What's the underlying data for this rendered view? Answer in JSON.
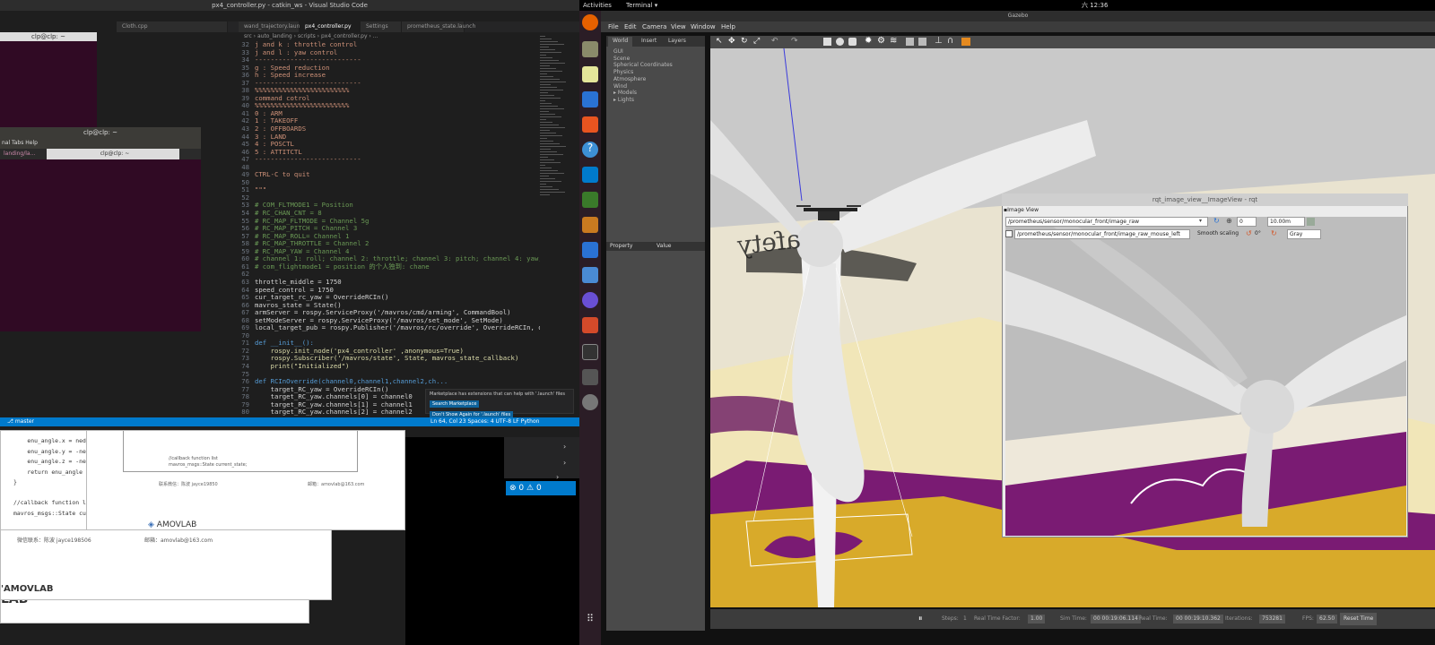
{
  "topbar": {
    "activities": "Activities",
    "app_menu": "Terminal ▾",
    "clock": "六 12:36",
    "app_name": "Gazebo"
  },
  "vscode": {
    "title": "px4_controller.py - catkin_ws - Visual Studio Code",
    "tabs": [
      "Cloth.cpp",
      "wand_trajectory.launch",
      "px4_controller.py",
      "Settings",
      "prometheus_state.launch"
    ],
    "breadcrumb": "src › auto_landing › scripts › px4_controller.py › ...",
    "code_lines": [
      {
        "n": "32",
        "t": "j and k : throttle control",
        "c": "cm"
      },
      {
        "n": "33",
        "t": "j and l : yaw control",
        "c": "cm"
      },
      {
        "n": "34",
        "t": "---------------------------",
        "c": "cm"
      },
      {
        "n": "35",
        "t": "g : Speed reduction",
        "c": "cm"
      },
      {
        "n": "36",
        "t": "h : Speed increase",
        "c": "cm"
      },
      {
        "n": "37",
        "t": "---------------------------",
        "c": "cm"
      },
      {
        "n": "38",
        "t": "%%%%%%%%%%%%%%%%%%%%%%%%",
        "c": "cm"
      },
      {
        "n": "39",
        "t": "command cotrol",
        "c": "cm"
      },
      {
        "n": "40",
        "t": "%%%%%%%%%%%%%%%%%%%%%%%%",
        "c": "cm"
      },
      {
        "n": "41",
        "t": "0 : ARM",
        "c": "cm"
      },
      {
        "n": "42",
        "t": "1 : TAKEOFF",
        "c": "cm"
      },
      {
        "n": "43",
        "t": "2 : OFFBOARDS",
        "c": "cm"
      },
      {
        "n": "44",
        "t": "3 : LAND",
        "c": "cm"
      },
      {
        "n": "45",
        "t": "4 : POSCTL",
        "c": "cm"
      },
      {
        "n": "46",
        "t": "5 : ATTITCTL",
        "c": "cm"
      },
      {
        "n": "47",
        "t": "---------------------------",
        "c": "cm"
      },
      {
        "n": "48",
        "t": "",
        "c": "tx"
      },
      {
        "n": "49",
        "t": "CTRL-C to quit",
        "c": "cm"
      },
      {
        "n": "50",
        "t": "",
        "c": "tx"
      },
      {
        "n": "51",
        "t": "\"\"\"",
        "c": "cm"
      },
      {
        "n": "52",
        "t": "",
        "c": "tx"
      },
      {
        "n": "53",
        "t": "# COM_FLTMODE1 = Position",
        "c": "cmt"
      },
      {
        "n": "54",
        "t": "# RC_CHAN_CNT = 8",
        "c": "cmt"
      },
      {
        "n": "55",
        "t": "# RC_MAP_FLTMODE = Channel 5g",
        "c": "cmt"
      },
      {
        "n": "56",
        "t": "# RC_MAP_PITCH = Channel 3",
        "c": "cmt"
      },
      {
        "n": "57",
        "t": "# RC_MAP_ROLL= Channel 1",
        "c": "cmt"
      },
      {
        "n": "58",
        "t": "# RC_MAP_THROTTLE = Channel 2",
        "c": "cmt"
      },
      {
        "n": "59",
        "t": "# RC_MAP_YAW = Channel 4",
        "c": "cmt"
      },
      {
        "n": "60",
        "t": "# channel 1: roll; channel 2: throttle; channel 3: pitch; channel 4: yaw; cha",
        "c": "cmt"
      },
      {
        "n": "61",
        "t": "# com_flightmode1 = position 的个人独到: chane",
        "c": "cmt"
      },
      {
        "n": "62",
        "t": "",
        "c": "tx"
      },
      {
        "n": "63",
        "t": "throttle_middle = 1750",
        "c": "tx"
      },
      {
        "n": "64",
        "t": "speed_control = 1750",
        "c": "tx"
      },
      {
        "n": "65",
        "t": "cur_target_rc_yaw = OverrideRCIn()",
        "c": "tx"
      },
      {
        "n": "66",
        "t": "mavros_state = State()",
        "c": "tx"
      },
      {
        "n": "67",
        "t": "armServer = rospy.ServiceProxy('/mavros/cmd/arming', CommandBool)",
        "c": "tx"
      },
      {
        "n": "68",
        "t": "setModeServer = rospy.ServiceProxy('/mavros/set_mode', SetMode)",
        "c": "tx"
      },
      {
        "n": "69",
        "t": "local_target_pub = rospy.Publisher('/mavros/rc/override', OverrideRCIn, queue",
        "c": "tx"
      },
      {
        "n": "70",
        "t": "",
        "c": "tx"
      },
      {
        "n": "71",
        "t": "def __init__():",
        "c": "kw"
      },
      {
        "n": "72",
        "t": "    rospy.init_node('px4_controller' ,anonymous=True)",
        "c": "fn"
      },
      {
        "n": "73",
        "t": "    rospy.Subscriber('/mavros/state', State, mavros_state_callback)",
        "c": "fn"
      },
      {
        "n": "74",
        "t": "    print(\"Initialized\")",
        "c": "fn"
      },
      {
        "n": "75",
        "t": "",
        "c": "tx"
      },
      {
        "n": "76",
        "t": "def RCInOverride(channel0,channel1,channel2,ch...",
        "c": "kw"
      },
      {
        "n": "77",
        "t": "    target_RC_yaw = OverrideRCIn()",
        "c": "tx"
      },
      {
        "n": "78",
        "t": "    target_RC_yaw.channels[0] = channel0",
        "c": "tx"
      },
      {
        "n": "79",
        "t": "    target_RC_yaw.channels[1] = channel1",
        "c": "tx"
      },
      {
        "n": "80",
        "t": "    target_RC_yaw.channels[2] = channel2",
        "c": "tx"
      }
    ],
    "notification": "Marketplace has extensions that can help with '.launch' files",
    "notif_btn1": "Search Marketplace",
    "notif_btn2": "Don't Show Again for '.launch' files",
    "status_left": "⎇ master",
    "status_right": "Ln 64, Col 23   Spaces: 4   UTF-8   LF   Python"
  },
  "terminal1": {
    "title": "clp@clp: ~"
  },
  "terminal2": {
    "title": "clp@clp: ~",
    "menu": "nal  Tabs  Help",
    "tab1": "landing/la...",
    "tab2": "clp@clp: ~"
  },
  "doc": {
    "code": [
      "    enu_angle.x = ned_a",
      "    enu_angle.y = -ned_a",
      "    enu_angle.z = -ned_a",
      "    return enu_angle",
      "}",
      "",
      "//callback function list",
      "mavros_msgs::State curre"
    ],
    "box_text1": "//callback function list",
    "box_text2": "mavros_msgs::State current_state;",
    "footer1a": "联系微信：陈波 jayce19850",
    "footer1b": "邮箱：amovlab@163.com",
    "logo": "AMOVLAB",
    "logo_bottom": "'AMOVLAB",
    "logo_cut": "LAB",
    "footer2a": "微信联系：陈波 jayce198506",
    "footer2b": "邮箱：amovlab@163.com",
    "errors": "0",
    "warnings": "0"
  },
  "gazebo": {
    "title": "Gazebo",
    "menu": [
      "File",
      "Edit",
      "Camera",
      "View",
      "Window",
      "Help"
    ],
    "tabs": [
      "World",
      "Insert",
      "Layers"
    ],
    "tree": [
      "GUI",
      "Scene",
      "Spherical Coordinates",
      "Physics",
      "Atmosphere",
      "Wind",
      "▸ Models",
      "▸ Lights"
    ],
    "prop_header": "Property",
    "value_header": "Value",
    "bottom": {
      "steps_label": "Steps:",
      "steps": "1",
      "rtf_label": "Real Time Factor:",
      "rtf": "1.00",
      "sim_label": "Sim Time:",
      "sim": "00 00:19:06.114",
      "real_label": "Real Time:",
      "real": "00 00:19:10.362",
      "iter_label": "Iterations:",
      "iter": "753281",
      "fps_label": "FPS:",
      "fps": "62.50",
      "reset": "Reset Time"
    },
    "scene_text": "afety"
  },
  "image_view": {
    "title": "rqt_image_view__ImageView - rqt",
    "panel": "Image View",
    "topic": "/prometheus/sensor/monocular_front/image_raw",
    "min": "0",
    "max": "10.00m",
    "mouse_topic": "/prometheus/sensor/monocular_front/image_raw_mouse_left",
    "smooth": "Smooth scaling",
    "rotation": "0°",
    "color": "Gray"
  }
}
